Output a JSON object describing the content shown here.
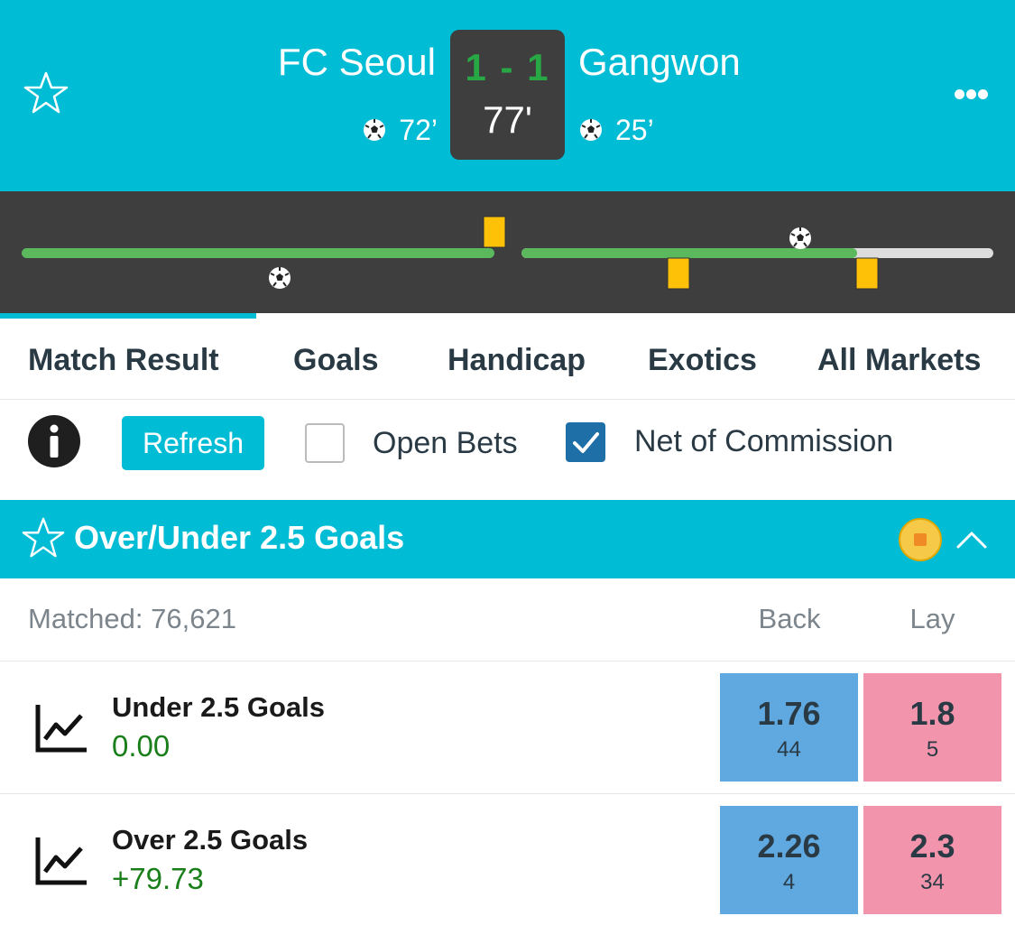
{
  "match": {
    "home_team": "FC Seoul",
    "away_team": "Gangwon",
    "score": "1 - 1",
    "clock": "77'",
    "home_goal_time": "72’",
    "away_goal_time": "25’"
  },
  "colors": {
    "header": "#00bcd4",
    "score_box": "#3e3e3e",
    "score_text": "#28a745",
    "timeline_bar": "#5cb85c",
    "card": "#ffc107",
    "back": "#5fa8e0",
    "lay": "#f394ad",
    "profit_text": "#1a7f1a"
  },
  "tabs": [
    {
      "label": "Match Result"
    },
    {
      "label": "Goals"
    },
    {
      "label": "Handicap"
    },
    {
      "label": "Exotics"
    },
    {
      "label": "All Markets"
    }
  ],
  "controls": {
    "refresh_label": "Refresh",
    "open_bets_label": "Open Bets",
    "open_bets_checked": false,
    "net_commission_label": "Net of Commission",
    "net_commission_checked": true
  },
  "market": {
    "title": "Over/Under 2.5 Goals",
    "matched_label": "Matched: 76,621",
    "back_label": "Back",
    "lay_label": "Lay",
    "runners": [
      {
        "name": "Under 2.5 Goals",
        "pl": "0.00",
        "back_price": "1.76",
        "back_size": "44",
        "lay_price": "1.8",
        "lay_size": "5"
      },
      {
        "name": "Over 2.5 Goals",
        "pl": "+79.73",
        "back_price": "2.26",
        "back_size": "4",
        "lay_price": "2.3",
        "lay_size": "34"
      }
    ]
  },
  "icons": [
    "star-icon",
    "more-icon",
    "soccer-ball-icon",
    "yellow-card-icon",
    "info-icon",
    "checkmark-icon",
    "coin-icon",
    "chevron-up-icon",
    "chart-icon"
  ]
}
